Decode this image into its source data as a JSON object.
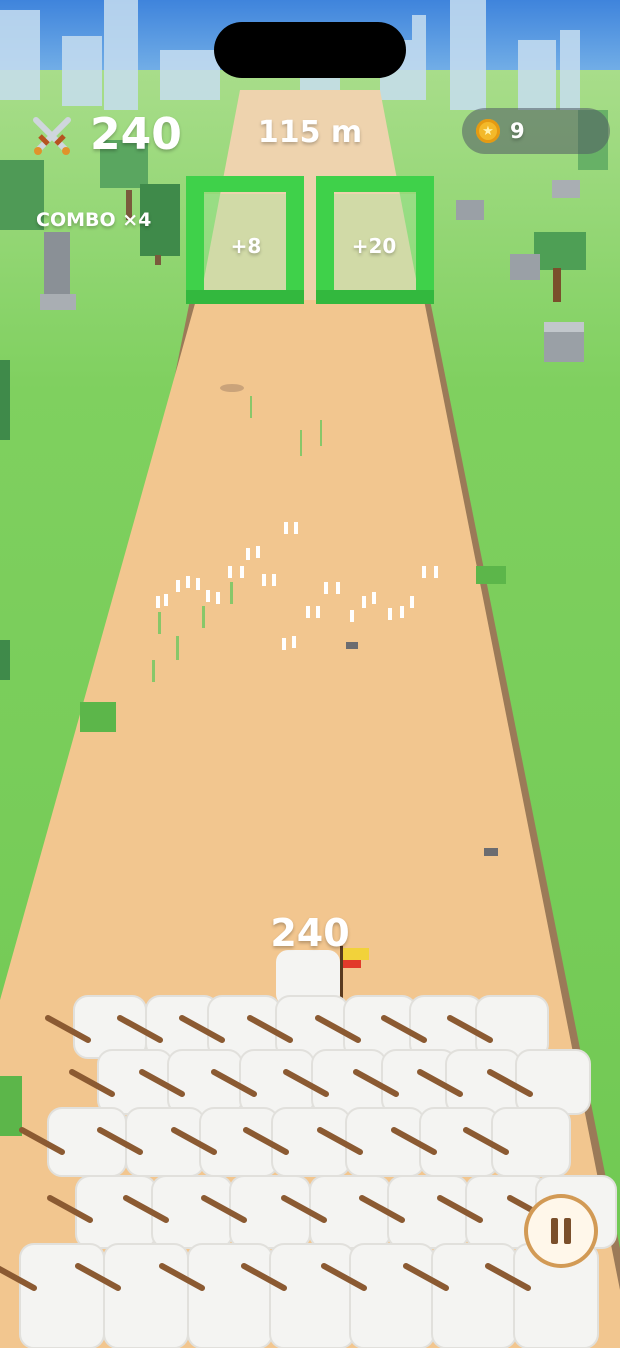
{
  "hud": {
    "score": "240",
    "distance": "115 m",
    "coins": "9",
    "combo": "COMBO ×4",
    "score_icon": "crossed-swords-icon",
    "coin_icon": "star-coin-icon"
  },
  "gates": [
    {
      "label": "+8"
    },
    {
      "label": "+20"
    }
  ],
  "army": {
    "count": "240"
  },
  "controls": {
    "pause_icon": "pause-icon"
  },
  "colors": {
    "grass": "#7ccd5d",
    "sky": "#4a8fe0",
    "track": "#f2c68f",
    "track_border": "#9b7a58",
    "gate": "#3fd14a",
    "pause_ring": "#d29a55"
  }
}
